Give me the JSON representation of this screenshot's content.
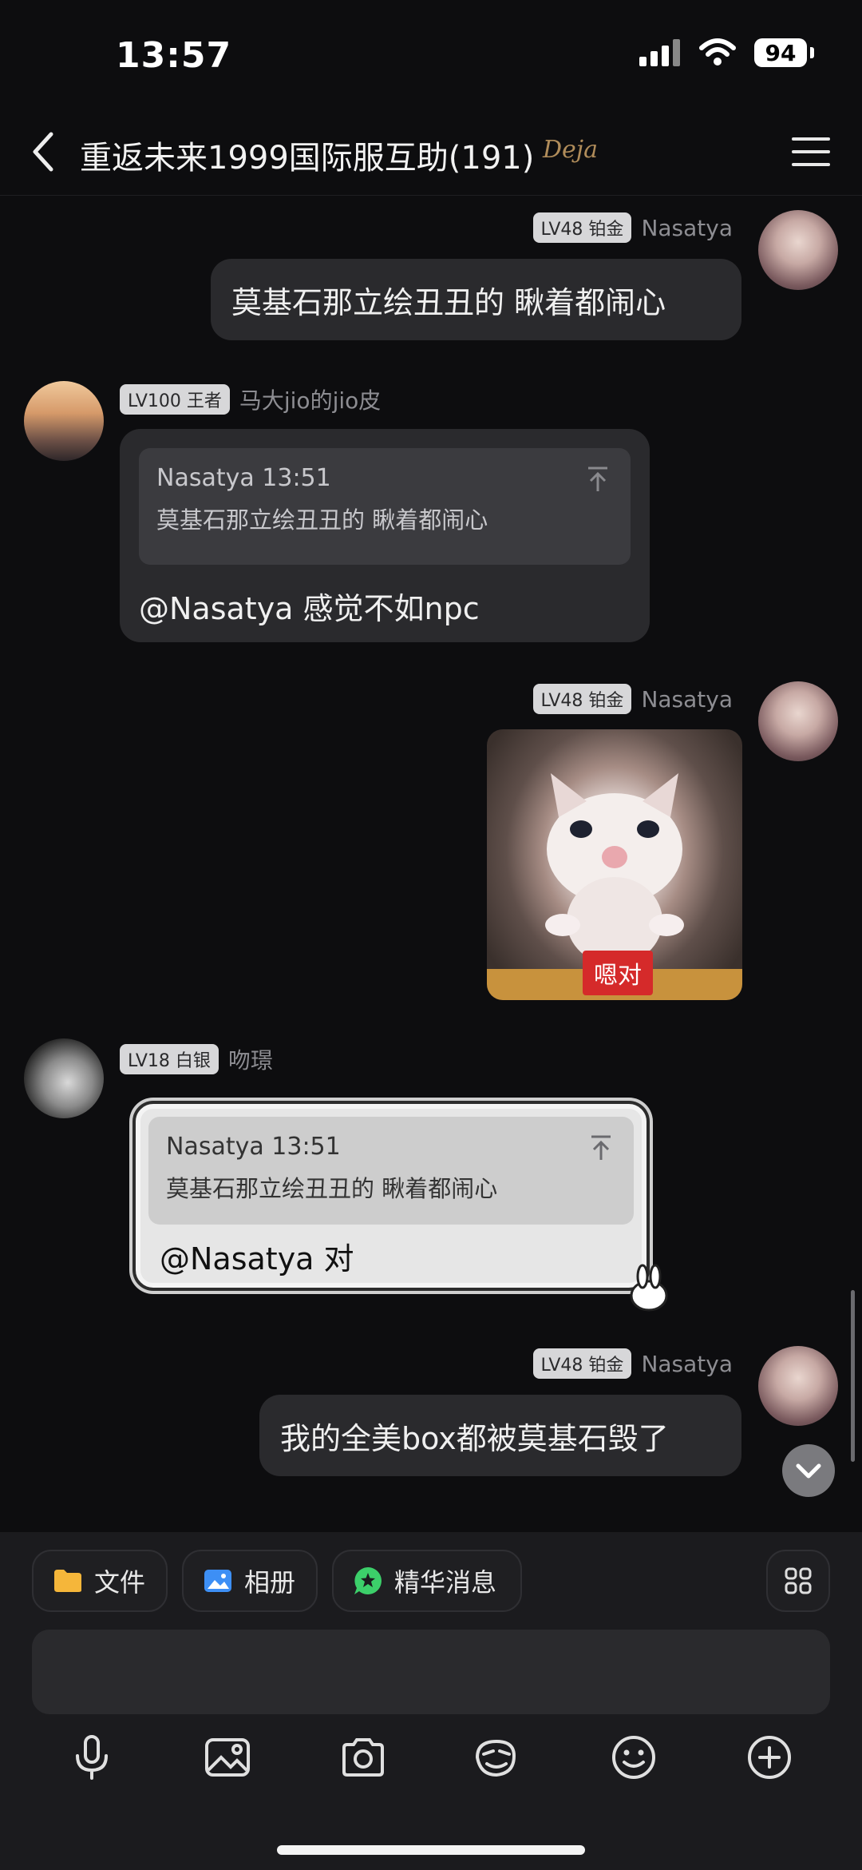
{
  "status_bar": {
    "time": "13:57",
    "battery": "94"
  },
  "header": {
    "title": "重返未来1999国际服互助(191)",
    "badge": "Deja"
  },
  "messages": [
    {
      "name": "Nasatya",
      "level": "LV48 铂金",
      "text": "莫基石那立绘丑丑的 瞅着都闹心"
    },
    {
      "name": "马大jio的jio皮",
      "level": "LV100 王者",
      "quote_head": "Nasatya 13:51",
      "quote_text": "莫基石那立绘丑丑的 瞅着都闹心",
      "text": "@Nasatya 感觉不如npc"
    },
    {
      "name": "Nasatya",
      "level": "LV48 铂金",
      "image_label": "嗯对"
    },
    {
      "name": "吻璟",
      "level": "LV18 白银",
      "quote_head": "Nasatya 13:51",
      "quote_text": "莫基石那立绘丑丑的 瞅着都闹心",
      "text": "@Nasatya 对"
    },
    {
      "name": "Nasatya",
      "level": "LV48 铂金",
      "text": "我的全美box都被莫基石毁了"
    }
  ],
  "quick_actions": [
    {
      "label": "文件",
      "icon": "folder-icon",
      "color": "#f5b63a"
    },
    {
      "label": "相册",
      "icon": "album-icon",
      "color": "#3d8ff5"
    },
    {
      "label": "精华消息",
      "icon": "star-bubble-icon",
      "color": "#3ccf6a"
    }
  ],
  "toolbar": [
    "microphone-icon",
    "image-icon",
    "camera-icon",
    "sticker-icon",
    "emoji-icon",
    "plus-icon"
  ]
}
